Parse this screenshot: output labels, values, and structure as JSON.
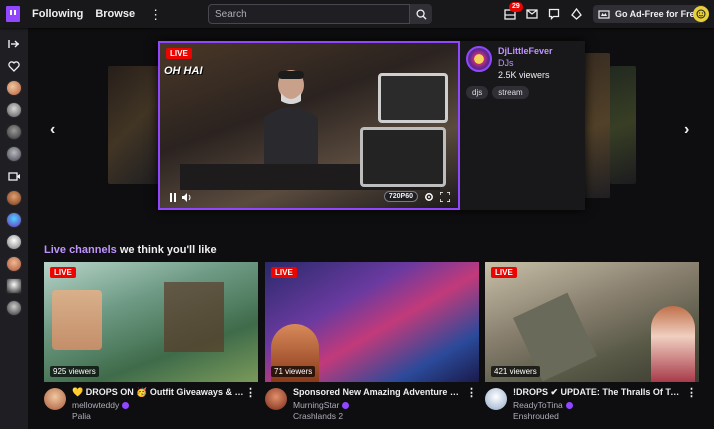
{
  "nav": {
    "following": "Following",
    "browse": "Browse",
    "more": "⋮",
    "search_placeholder": "Search",
    "notification_count": "29",
    "ad_free_label": "Go Ad-Free for Free"
  },
  "sidebar": {
    "collapse_icon": "collapse-arrow-icon",
    "heart_icon": "heart-icon",
    "camera_icon": "video-camera-icon"
  },
  "featured": {
    "live": "LIVE",
    "overlay_text": "OH HAI",
    "channel": "DjLittleFever",
    "category": "DJs",
    "viewers": "2.5K viewers",
    "tags": [
      "djs",
      "stream"
    ],
    "quality": "720P60"
  },
  "section": {
    "title_accent": "Live channels",
    "title_rest": " we think you'll like"
  },
  "cards": [
    {
      "live": "LIVE",
      "viewers": "925 viewers",
      "title": "💛 DROPS ON 🥳 Outfit Giveaways & Elderwood",
      "channel": "mellowteddy",
      "game": "Palia"
    },
    {
      "live": "LIVE",
      "viewers": "71 viewers",
      "title": "Sponsored New Amazing Adventure Game...",
      "channel": "MurningStar",
      "game": "Crashlands 2"
    },
    {
      "live": "LIVE",
      "viewers": "421 viewers",
      "title": "!DROPS ✔ UPDATE: The Thralls Of Twilight",
      "channel": "ReadyToTina",
      "game": "Enshrouded"
    }
  ],
  "colors": {
    "brand": "#9147ff",
    "live": "#eb0400",
    "accent_text": "#bf94ff"
  }
}
